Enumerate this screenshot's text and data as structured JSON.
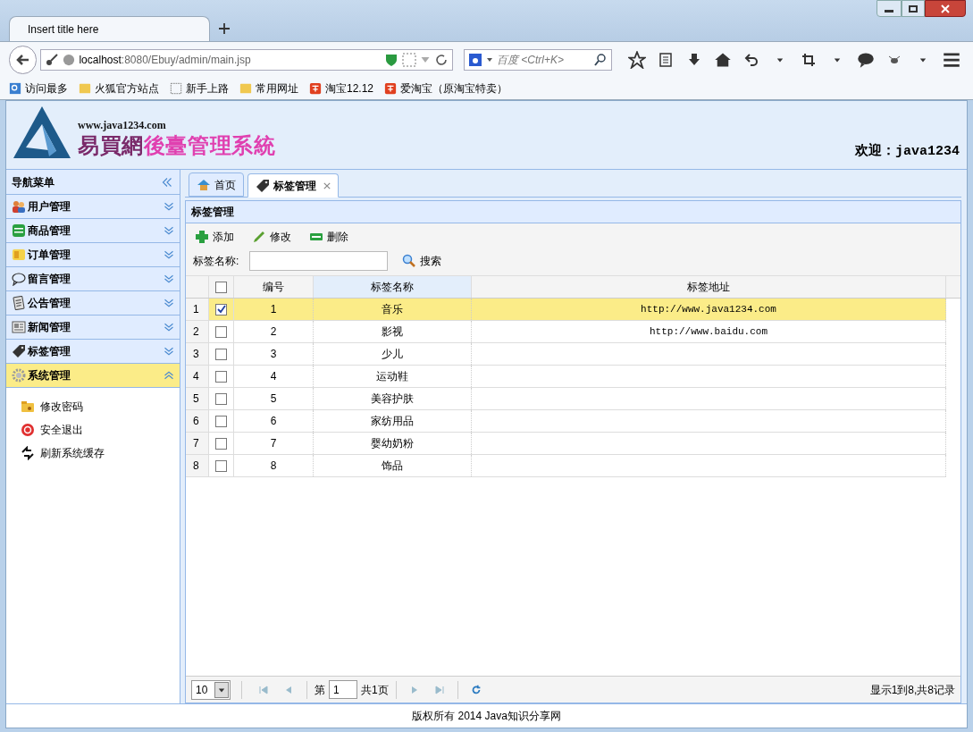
{
  "browser": {
    "tab_title": "Insert title here",
    "url_host": "localhost",
    "url_path": ":8080/Ebuy/admin/main.jsp",
    "search_placeholder": "百度 <Ctrl+K>",
    "bookmarks": [
      {
        "kind": "search",
        "label": "访问最多"
      },
      {
        "kind": "folder",
        "label": "火狐官方站点"
      },
      {
        "kind": "page",
        "label": "新手上路"
      },
      {
        "kind": "folder",
        "label": "常用网址"
      },
      {
        "kind": "tao",
        "label": "淘宝12.12"
      },
      {
        "kind": "tao",
        "label": "爱淘宝（原淘宝特卖）"
      }
    ]
  },
  "header": {
    "site": "www.java1234.com",
    "title_a": "易買網",
    "title_b": "後臺管理系統",
    "welcome": "欢迎：java1234"
  },
  "sidebar": {
    "title": "导航菜单",
    "items": [
      {
        "kind": "users",
        "label": "用户管理",
        "expanded": false
      },
      {
        "kind": "goods",
        "label": "商品管理",
        "expanded": false
      },
      {
        "kind": "order",
        "label": "订单管理",
        "expanded": false
      },
      {
        "kind": "message",
        "label": "留言管理",
        "expanded": false
      },
      {
        "kind": "notice",
        "label": "公告管理",
        "expanded": false
      },
      {
        "kind": "news",
        "label": "新闻管理",
        "expanded": false
      },
      {
        "kind": "tag",
        "label": "标签管理",
        "expanded": false
      },
      {
        "kind": "gear",
        "label": "系统管理",
        "expanded": true,
        "children": [
          {
            "kind": "password",
            "label": "修改密码"
          },
          {
            "kind": "exit",
            "label": "安全退出"
          },
          {
            "kind": "refresh",
            "label": "刷新系统缓存"
          }
        ]
      }
    ]
  },
  "tabs": [
    {
      "kind": "home",
      "label": "首页",
      "selected": false,
      "closable": false
    },
    {
      "kind": "tag",
      "label": "标签管理",
      "selected": true,
      "closable": true
    }
  ],
  "panel": {
    "title": "标签管理",
    "toolbar": [
      {
        "kind": "add",
        "label": "添加"
      },
      {
        "kind": "edit",
        "label": "修改"
      },
      {
        "kind": "delete",
        "label": "删除"
      }
    ],
    "search_label": "标签名称:",
    "search_button": "搜索"
  },
  "table": {
    "all_checked": false,
    "columns": [
      {
        "label": "编号",
        "highlighted": false
      },
      {
        "label": "标签名称",
        "highlighted": true
      },
      {
        "label": "标签地址",
        "highlighted": false
      }
    ],
    "rows": [
      {
        "index": "1",
        "selected": true,
        "cells": [
          "1",
          "音乐",
          "http://www.java1234.com"
        ]
      },
      {
        "index": "2",
        "selected": false,
        "cells": [
          "2",
          "影视",
          "http://www.baidu.com"
        ]
      },
      {
        "index": "3",
        "selected": false,
        "cells": [
          "3",
          "少儿"
        ]
      },
      {
        "index": "4",
        "selected": false,
        "cells": [
          "4",
          "运动鞋"
        ]
      },
      {
        "index": "5",
        "selected": false,
        "cells": [
          "5",
          "美容护肤"
        ]
      },
      {
        "index": "6",
        "selected": false,
        "cells": [
          "6",
          "家纺用品"
        ]
      },
      {
        "index": "7",
        "selected": false,
        "cells": [
          "7",
          "婴幼奶粉"
        ]
      },
      {
        "index": "8",
        "selected": false,
        "cells": [
          "8",
          "饰品"
        ]
      }
    ]
  },
  "pager": {
    "page_size": "10",
    "page_before": "第",
    "page": "1",
    "page_after": "共1页",
    "summary": "显示1到8,共8记录"
  },
  "footer": "版权所有 2014 Java知识分享网"
}
